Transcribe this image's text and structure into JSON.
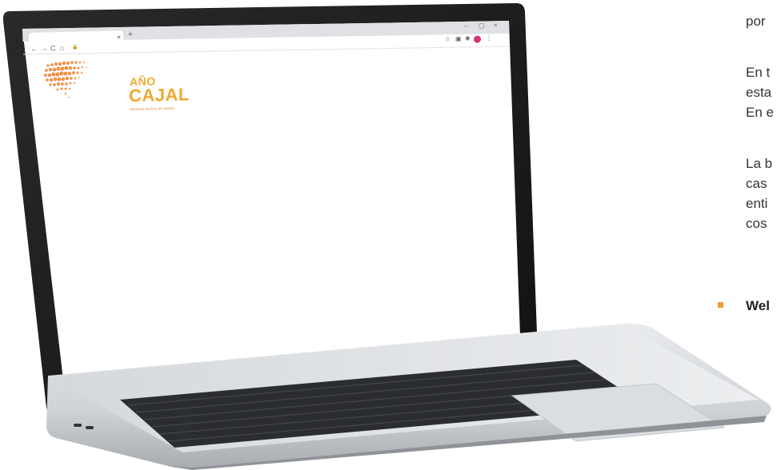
{
  "browser": {
    "tab_close": "×",
    "new_tab": "+",
    "window_controls": [
      "–",
      "▢",
      "×"
    ],
    "nav": [
      "←",
      "→",
      "C",
      "⌂"
    ],
    "url_lock": "🔒",
    "right_icons": [
      "☆",
      "▣",
      "✱",
      "⋮"
    ]
  },
  "logo": {
    "line1": "AÑO",
    "line2": "CAJAL",
    "tagline": "Estamos hechos de ciencia"
  },
  "side_text": {
    "lines": [
      "por",
      "En t",
      "esta",
      "En e",
      "La b",
      "cas",
      "enti",
      "cos"
    ],
    "bullet_label": "Wel"
  },
  "colors": {
    "logo_orange": "#f0a830",
    "bullet": "#f29a34",
    "laptop_bezel": "#1f1f1f",
    "screen_bg": "#ffffff",
    "aluminum": "#cfd2d6"
  },
  "icons": [
    "laptop-icon",
    "close-icon",
    "plus-icon",
    "back-icon",
    "forward-icon",
    "reload-icon",
    "home-icon",
    "lock-icon",
    "star-icon",
    "extension-icon",
    "menu-icon"
  ]
}
